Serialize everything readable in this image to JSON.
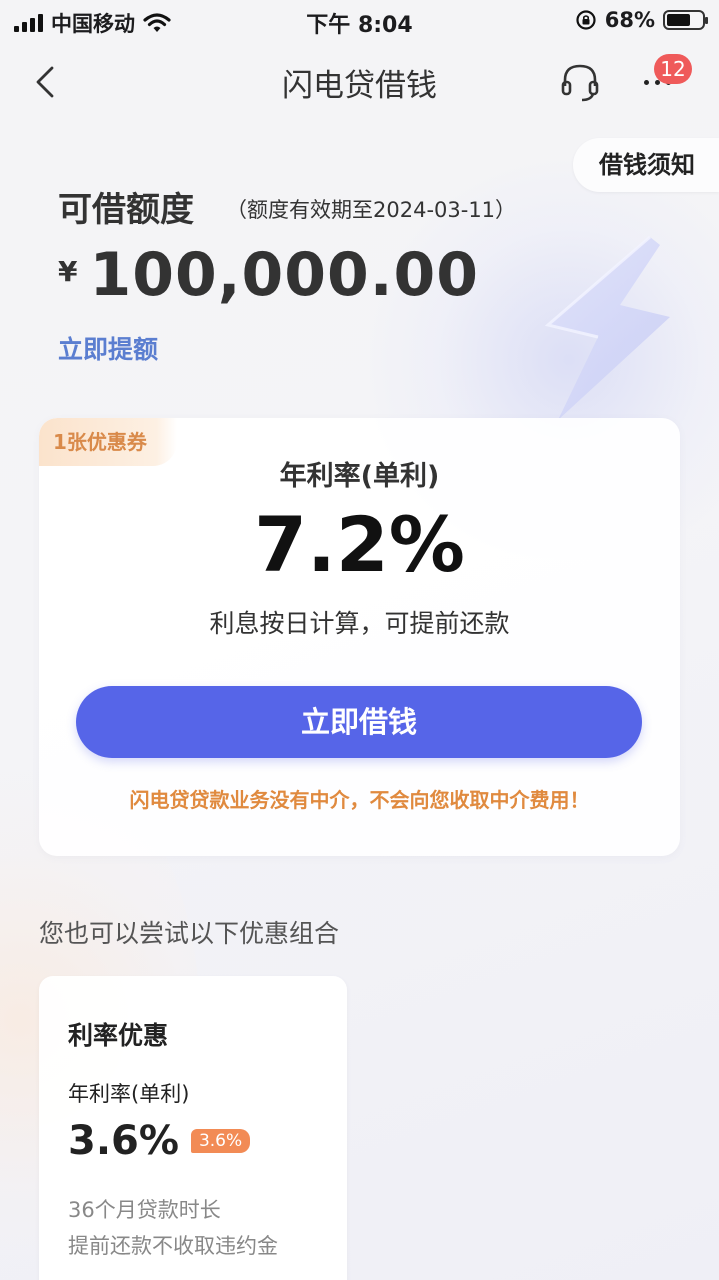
{
  "status_bar": {
    "carrier": "中国移动",
    "time": "下午 8:04",
    "battery_percent": "68%",
    "battery_level": 0.68
  },
  "nav": {
    "title": "闪电贷借钱",
    "badge_count": "12"
  },
  "notice_button": "借钱须知",
  "quota": {
    "title": "可借额度",
    "validity_note": "（额度有效期至2024-03-11）",
    "currency": "¥",
    "amount": "100,000.00",
    "raise_link": "立即提额"
  },
  "main_card": {
    "coupon_tag": "1张优惠券",
    "rate_label": "年利率(单利)",
    "rate_value": "7.2%",
    "rate_desc": "利息按日计算，可提前还款",
    "borrow_button": "立即借钱",
    "disclaimer": "闪电贷贷款业务没有中介，不会向您收取中介费用！"
  },
  "section": {
    "title": "您也可以尝试以下优惠组合"
  },
  "offer_card": {
    "title": "利率优惠",
    "rate_label": "年利率(单利)",
    "rate_value": "3.6%",
    "rate_tag": "3.6%",
    "line1": "36个月贷款时长",
    "line2": "提前还款不收取违约金"
  },
  "colors": {
    "primary_button": "#5665e8",
    "link": "#5b7ed0",
    "warning_text": "#e08a3f",
    "badge": "#ef5a5a",
    "rate_tag": "#f28b55"
  },
  "icons": [
    "back-chevron-icon",
    "headset-icon",
    "more-dots-icon",
    "wifi-icon",
    "signal-icon",
    "lock-rotation-icon",
    "battery-icon",
    "lightning-bolt-icon"
  ]
}
